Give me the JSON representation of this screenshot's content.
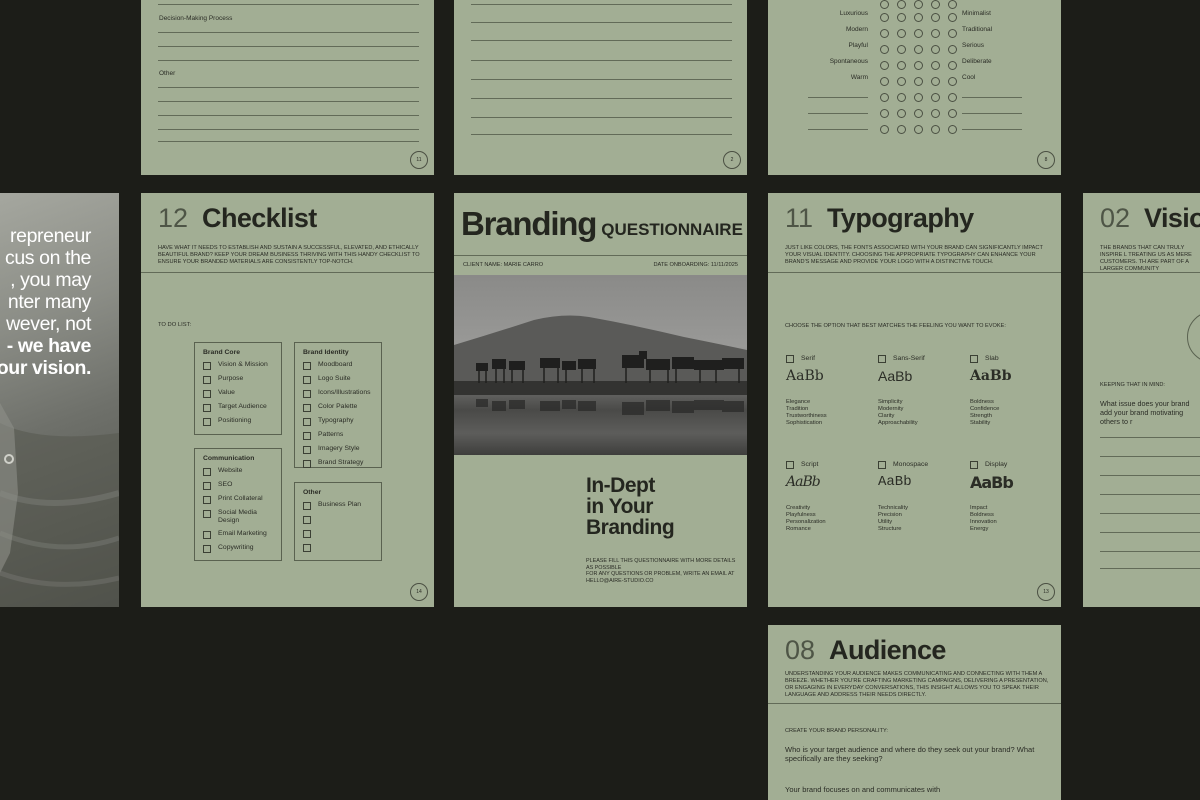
{
  "top_left": {
    "labels": [
      "Decision-Making Process",
      "Other"
    ],
    "page_number": "11"
  },
  "top_middle": {
    "page_number": "2"
  },
  "top_right": {
    "rows": [
      {
        "left": "Luxurious",
        "right": "Minimalist"
      },
      {
        "left": "Modern",
        "right": "Traditional"
      },
      {
        "left": "Playful",
        "right": "Serious"
      },
      {
        "left": "Spontaneous",
        "right": "Deliberate"
      },
      {
        "left": "Warm",
        "right": "Cool"
      }
    ],
    "page_number": "8"
  },
  "quote": {
    "lines": [
      "repreneur",
      "cus on the",
      ", you may",
      "nter many",
      "wever, not"
    ],
    "bold_lines": [
      "- we have",
      "our vision."
    ]
  },
  "checklist": {
    "number": "12",
    "title": "Checklist",
    "intro": "Have what it needs to establish and sustain a successful, elevated, and ethically beautiful brand? Keep your dream business thriving with this handy checklist to ensure your branded materials are consistently top-notch.",
    "todo_label": "To do list:",
    "groups": [
      {
        "title": "Brand Core",
        "items": [
          "Vision & Mission",
          "Purpose",
          "Value",
          "Target Audience",
          "Positioning"
        ]
      },
      {
        "title": "Brand Identity",
        "items": [
          "Moodboard",
          "Logo Suite",
          "Icons/Illustrations",
          "Color Palette",
          "Typography",
          "Patterns",
          "Imagery Style",
          "Brand Strategy"
        ]
      },
      {
        "title": "Communication",
        "items": [
          "Website",
          "SEO",
          "Print Collateral",
          "Social Media Design",
          "Email Marketing",
          "Copywriting"
        ]
      },
      {
        "title": "Other",
        "items": [
          "Business Plan",
          "",
          "",
          ""
        ]
      }
    ],
    "page_number": "14"
  },
  "cover": {
    "title_big": "Branding",
    "title_small": "QUESTIONNAIRE",
    "client": "Client name: Marie Carro",
    "date": "Date onboarding: 11/11/2025",
    "headline": [
      "In-Dept",
      "in Your",
      "Branding"
    ],
    "instructions": [
      "Please fill this questionnaire with more details",
      "as possible",
      "For any questions or problem, write an email at",
      "hello@aire-studio.co"
    ]
  },
  "typography": {
    "number": "11",
    "title": "Typography",
    "intro": "Just like colors, the fonts associated with your brand can significantly impact your visual identity. Choosing the appropriate typography can enhance your brand's message and provide your logo with a distinctive touch.",
    "prompt": "Choose the option that best matches the feeling you want to evoke:",
    "options": [
      {
        "name": "Serif",
        "sample": "AaBb",
        "traits": [
          "Elegance",
          "Tradition",
          "Trustworthiness",
          "Sophistication"
        ]
      },
      {
        "name": "Sans-Serif",
        "sample": "AaBb",
        "traits": [
          "Simplicity",
          "Modernity",
          "Clarity",
          "Approachability"
        ]
      },
      {
        "name": "Slab",
        "sample": "AaBb",
        "traits": [
          "Boldness",
          "Confidence",
          "Strength",
          "Stability"
        ]
      },
      {
        "name": "Script",
        "sample": "AaBb",
        "traits": [
          "Creativity",
          "Playfulness",
          "Personalization",
          "Romance"
        ]
      },
      {
        "name": "Monospace",
        "sample": "AaBb",
        "traits": [
          "Technicality",
          "Precision",
          "Utility",
          "Structure"
        ]
      },
      {
        "name": "Display",
        "sample": "AaBb",
        "traits": [
          "Impact",
          "Boldness",
          "Innovation",
          "Energy"
        ]
      }
    ],
    "page_number": "13"
  },
  "vision": {
    "number": "02",
    "title": "Visio",
    "intro": "The brands that can truly inspire l treating us as mere customers. Th are part of a larger community",
    "keeping": "Keeping that in mind:",
    "question": "What issue does your brand add your brand motivating others to r"
  },
  "audience": {
    "number": "08",
    "title": "Audience",
    "intro": "Understanding your audience makes communicating and connecting with them a breeze. Whether you're crafting marketing campaigns, delivering a presentation, or engaging in everyday conversations, this insight allows you to speak their language and address their needs directly.",
    "label": "Create your brand personality:",
    "question": "Who is your target audience and where do they seek out your brand? What specifically are they seeking?",
    "answer_start": "Your brand focuses on and communicates with"
  }
}
